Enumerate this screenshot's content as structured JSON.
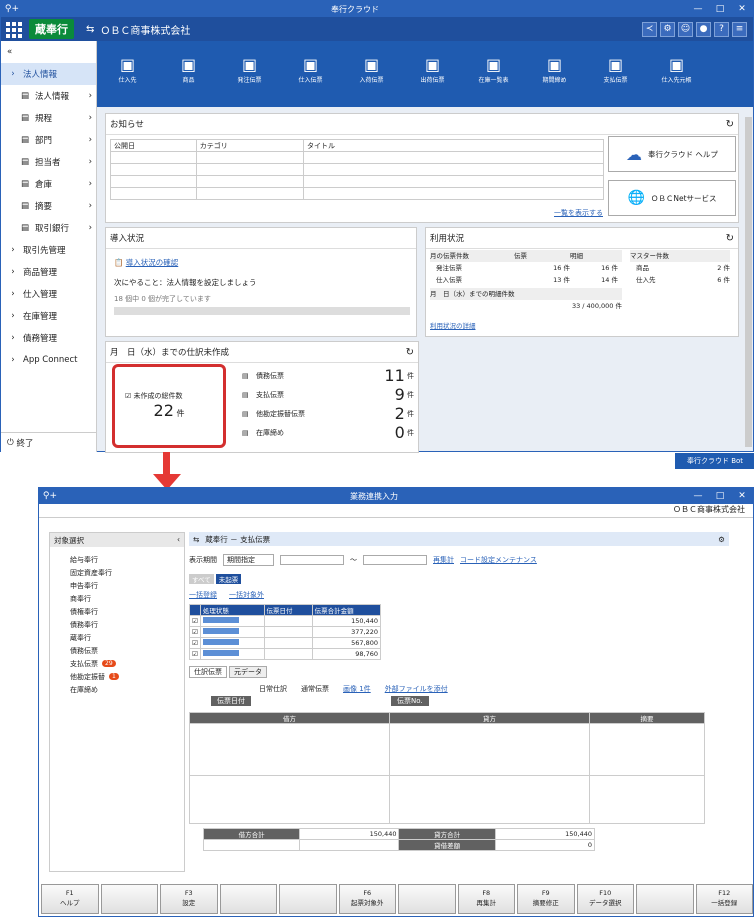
{
  "app": {
    "title": "奉行クラウド",
    "logo": "蔵奉行",
    "company": "ＯＢＣ商事株式会社"
  },
  "sidebar": {
    "collapse": "«",
    "items": [
      {
        "label": "法人情報",
        "sub": false,
        "active": true
      },
      {
        "label": "法人情報",
        "sub": true
      },
      {
        "label": "規程",
        "sub": true
      },
      {
        "label": "部門",
        "sub": true
      },
      {
        "label": "担当者",
        "sub": true
      },
      {
        "label": "倉庫",
        "sub": true
      },
      {
        "label": "摘要",
        "sub": true
      },
      {
        "label": "取引銀行",
        "sub": true
      },
      {
        "label": "取引先管理",
        "sub": false
      },
      {
        "label": "商品管理",
        "sub": false
      },
      {
        "label": "仕入管理",
        "sub": false
      },
      {
        "label": "在庫管理",
        "sub": false
      },
      {
        "label": "債務管理",
        "sub": false
      },
      {
        "label": "App Connect",
        "sub": false
      }
    ],
    "footer": "終了"
  },
  "toolbar": [
    "仕入先",
    "商品",
    "発注伝票",
    "仕入伝票",
    "入荷伝票",
    "出荷伝票",
    "在庫一覧表",
    "期間締め",
    "支払伝票",
    "仕入先元帳"
  ],
  "notice": {
    "title": "お知らせ",
    "cols": [
      "公開日",
      "カテゴリ",
      "タイトル"
    ],
    "more": "一覧を表示する",
    "btn1": "奉行クラウド ヘルプ",
    "btn2": "ＯＢＣNetサービス"
  },
  "intro": {
    "title": "導入状況",
    "link": "導入状況の確認",
    "next": "次にやること：法人情報を設定しましょう",
    "progress": "18 個中 0 個が完了しています"
  },
  "usage": {
    "title": "利用状況",
    "h1": "月の伝票件数",
    "c1": "伝票",
    "c2": "明細",
    "r1": "発注伝票",
    "r1a": "16 件",
    "r1b": "16 件",
    "r2": "仕入伝票",
    "r2a": "13 件",
    "r2b": "14 件",
    "h2": "月　日（水）までの明細件数",
    "v2": "33 / 400,000 件",
    "link": "利用状況の詳細",
    "m": "マスター件数",
    "m1": "商品",
    "m1v": "2 件",
    "m2": "仕入先",
    "m2v": "6 件"
  },
  "pending": {
    "title": "月　日（水）までの仕訳未作成",
    "card": "未作成の総件数",
    "total": "22",
    "unit": "件",
    "rows": [
      [
        "債務伝票",
        "11"
      ],
      [
        "支払伝票",
        "9"
      ],
      [
        "他勘定振替伝票",
        "2"
      ],
      [
        "在庫締め",
        "0"
      ]
    ]
  },
  "bot": "奉行クラウド Bot",
  "win2": {
    "title": "業務連携入力",
    "company": "ＯＢＣ商事株式会社",
    "tree_title": "対象選択",
    "tree": [
      [
        "給与奉行",
        ""
      ],
      [
        "固定資産奉行",
        ""
      ],
      [
        "申告奉行",
        ""
      ],
      [
        "商奉行",
        ""
      ],
      [
        "債権奉行",
        ""
      ],
      [
        "債務奉行",
        ""
      ],
      [
        "蔵奉行",
        ""
      ],
      [
        "債務伝票",
        ""
      ],
      [
        "支払伝票",
        "29"
      ],
      [
        "他勘定振替",
        "1"
      ],
      [
        "在庫締め",
        ""
      ]
    ],
    "crumb": "蔵奉行 － 支払伝票",
    "period_label": "表示期間",
    "period": "期間指定",
    "recalc": "再集計",
    "maint": "コード設定メンテナンス",
    "tab_all": "すべて",
    "tab_un": "未起票",
    "reg": "一括登録",
    "exc": "一括対象外",
    "listcols": [
      "処理状態",
      "伝票日付",
      "伝票合計金額"
    ],
    "amounts": [
      "150,440",
      "377,220",
      "567,800",
      "98,760"
    ],
    "subtabs": [
      "仕訳伝票",
      "元データ"
    ],
    "kind": "日常仕訳",
    "normal": "通常伝票",
    "img": "画像 1件",
    "ext": "外部ファイルを添付",
    "date": "伝票日付",
    "no": "伝票No.",
    "jh": [
      "借方",
      "貸方",
      "摘要"
    ],
    "tot1": "借方合計",
    "tot1v": "150,440",
    "tot2": "貸方合計",
    "tot2v": "150,440",
    "diff": "貸借差額",
    "diffv": "0",
    "fkeys": [
      [
        "F1",
        "ヘルプ"
      ],
      [
        "",
        ""
      ],
      [
        "F3",
        "設定"
      ],
      [
        "",
        ""
      ],
      [
        "",
        ""
      ],
      [
        "F6",
        "起票対象外"
      ],
      [
        "",
        ""
      ],
      [
        "F8",
        "再集計"
      ],
      [
        "F9",
        "摘要修正"
      ],
      [
        "F10",
        "データ選択"
      ],
      [
        "",
        ""
      ],
      [
        "F12",
        "一括登録"
      ]
    ]
  }
}
